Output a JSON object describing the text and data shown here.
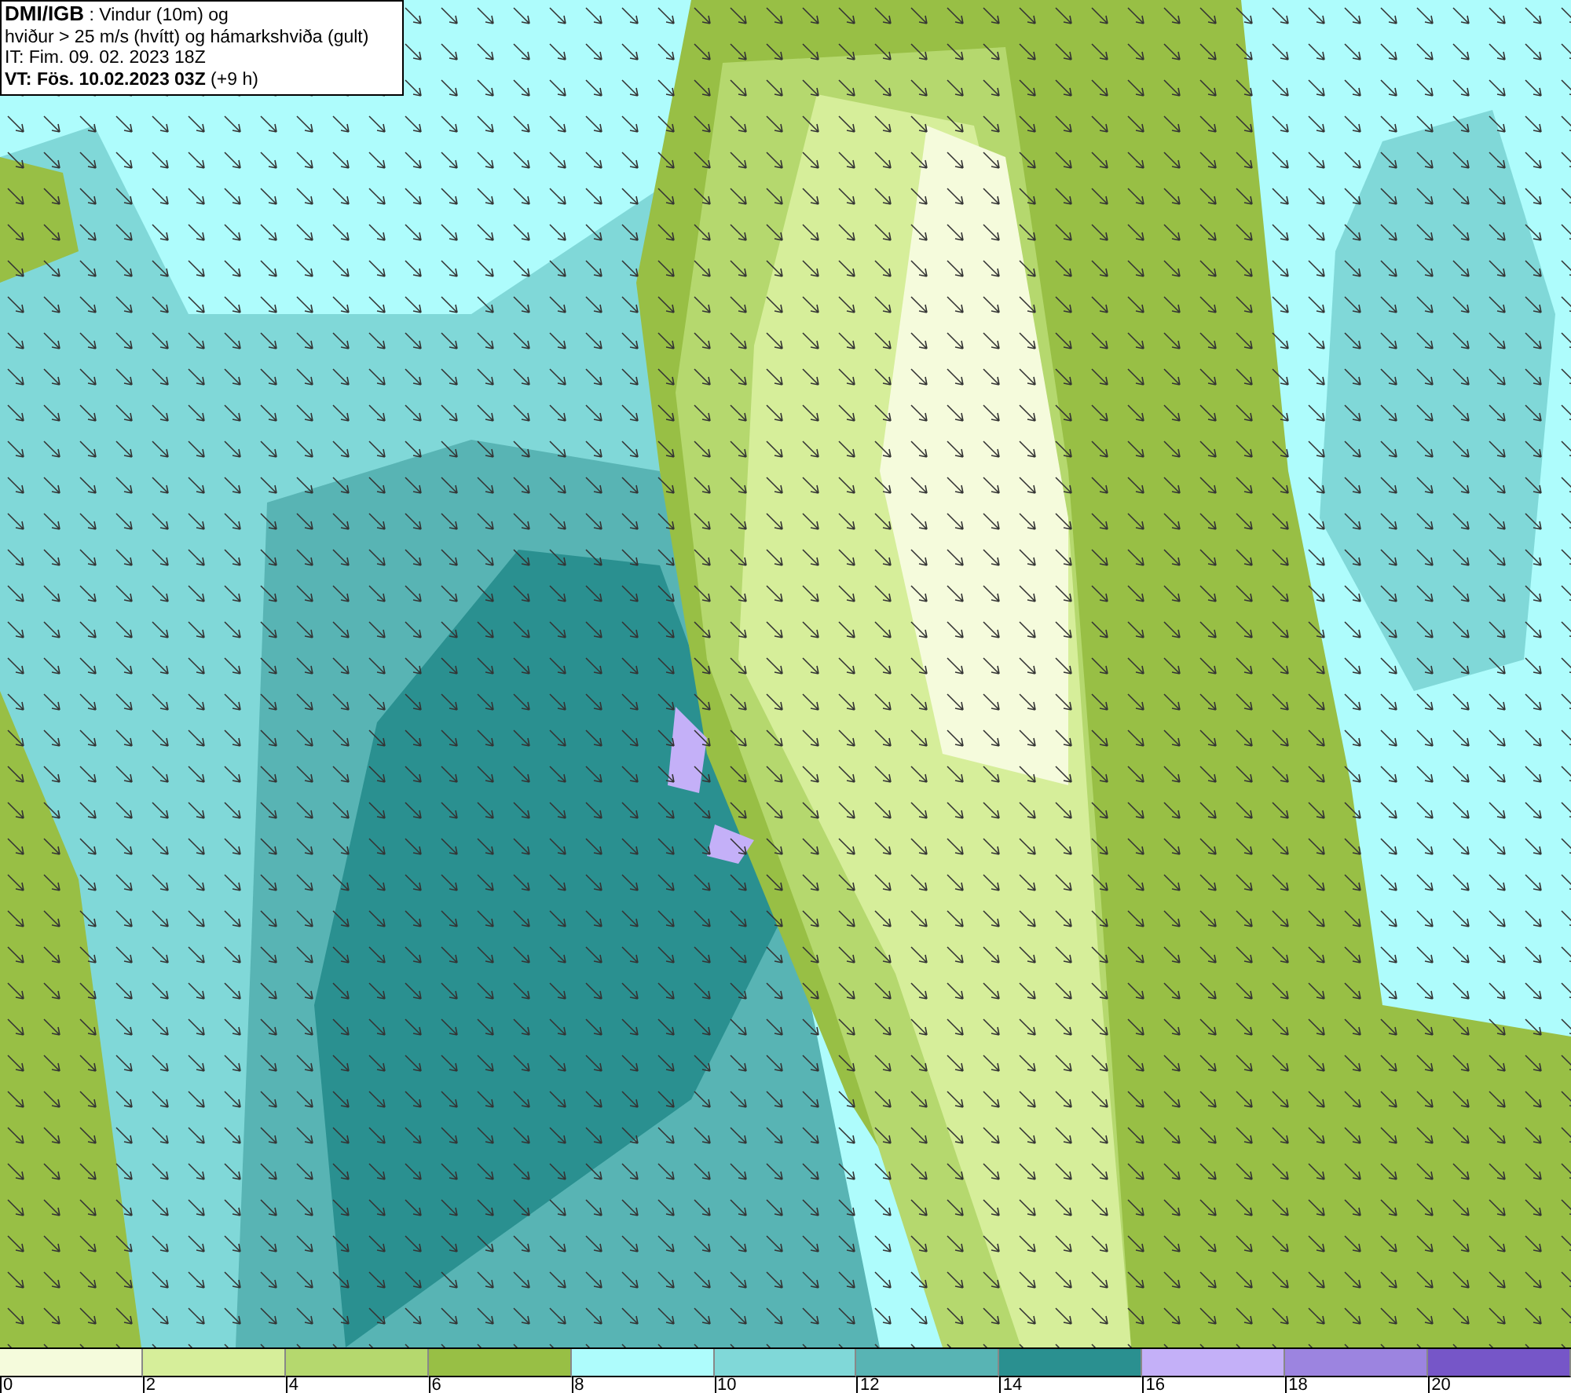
{
  "info_box": {
    "lines": [
      "**DMI/IGB** : Vindur (10m) og",
      "hviður > 25 m/s (hvítt) og hámarkshviða (gult)",
      "IT: Fim. 09. 02. 2023 18Z",
      "**VT: Fös. 10.02.2023 03Z** (+9 h)"
    ]
  },
  "legend": {
    "bins": [
      {
        "color": "#f5fbdc",
        "label": "0"
      },
      {
        "color": "#d6ee9a",
        "label": "2"
      },
      {
        "color": "#b5d86e",
        "label": "4"
      },
      {
        "color": "#98bf45",
        "label": "6"
      },
      {
        "color": "#aefcfc",
        "label": "8"
      },
      {
        "color": "#80d8d8",
        "label": "10"
      },
      {
        "color": "#58b4b4",
        "label": "12"
      },
      {
        "color": "#2a9090",
        "label": "14"
      },
      {
        "color": "#c4b0f8",
        "label": "16"
      },
      {
        "color": "#9c84e0",
        "label": "18"
      },
      {
        "color": "#7656c8",
        "label": "20"
      }
    ]
  }
}
